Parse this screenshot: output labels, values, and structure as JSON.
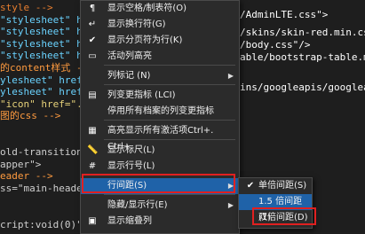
{
  "code_lines": [
    "style -->",
    "\"stylesheet\" href",
    "\"stylesheet\" href",
    "\"stylesheet\" href",
    "\"stylesheet\" href",
    "的content样式 -",
    "ylesheet\" href",
    "ylesheet\" href",
    "\"icon\" href=\"./",
    "图的css -->",
    "",
    "",
    "old-transition s",
    "apper\">",
    "eader -->",
    "ss=\"main-heade",
    "",
    "",
    "cript:void(0)\" ("
  ],
  "right_code_lines": [
    {
      "text": "/AdminLTE.css\">",
      "color": "#ffffff"
    },
    {
      "text": "/skins/skin-red.min.cs",
      "color": "#ffffff"
    },
    {
      "text": "/body.css\"/>",
      "color": "#ffffff"
    },
    {
      "text": "able/bootstrap-table.min",
      "color": "#ffffff"
    },
    {
      "text": "ins/googleapis/googleap",
      "color": "#ffffff"
    }
  ],
  "context_menu": {
    "items": [
      {
        "icon": "show-whitespace-icon",
        "glyph": "¶",
        "label": "显示空格/制表符(O)",
        "arrow": false
      },
      {
        "icon": "show-newline-icon",
        "glyph": "↵",
        "label": "显示换行符(G)",
        "arrow": false
      },
      {
        "icon": "check-icon",
        "glyph": "✔",
        "label": "显示分页符为行(K)",
        "arrow": false
      },
      {
        "icon": "highlight-active-icon",
        "glyph": "▭",
        "label": "活动列高亮",
        "arrow": false
      },
      {
        "icon": "",
        "glyph": "",
        "label": "列标记 (N)",
        "arrow": true
      },
      {
        "icon": "column-change-icon",
        "glyph": "▤",
        "label": "列变更指标 (LCI)",
        "arrow": false
      },
      {
        "icon": "",
        "glyph": "",
        "label": "停用所有档案的列变更指标",
        "arrow": false
      },
      {
        "icon": "highlight-all-icon",
        "glyph": "▦",
        "label": "高亮显示所有激活项Ctrl+. Ctrl+.",
        "arrow": false
      },
      {
        "icon": "ruler-icon",
        "glyph": "📏",
        "label": "显示标尺(L)",
        "arrow": false
      },
      {
        "icon": "line-number-icon",
        "glyph": "#",
        "label": "显示行号(L)",
        "arrow": false
      },
      {
        "icon": "",
        "glyph": "",
        "label": "行间距(S)",
        "arrow": true
      },
      {
        "icon": "",
        "glyph": "",
        "label": "隐藏/显示行(E)",
        "arrow": true
      },
      {
        "icon": "fold-icon",
        "glyph": "▣",
        "label": "显示缩叠列",
        "arrow": false
      }
    ]
  },
  "submenu": {
    "items": [
      {
        "label": "单倍间距(S)",
        "checked": true
      },
      {
        "label": "1.5 倍间距(1)",
        "checked": false
      },
      {
        "label": "双倍间距(D)",
        "checked": false
      }
    ]
  }
}
